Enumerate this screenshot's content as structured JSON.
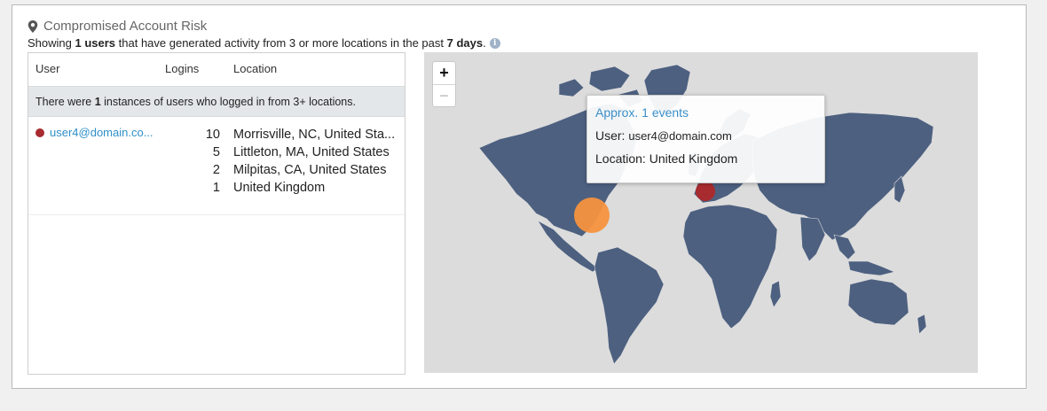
{
  "widget": {
    "title": "Compromised Account Risk",
    "subtitle": {
      "prefix": "Showing ",
      "user_count": "1 users",
      "middle": " that have generated activity from 3 or more locations in the past ",
      "period": "7 days",
      "suffix": "."
    }
  },
  "table": {
    "headers": {
      "user": "User",
      "logins": "Logins",
      "location": "Location"
    },
    "banner": {
      "prefix": "There were ",
      "count": "1",
      "suffix": " instances of users who logged in from 3+ locations."
    },
    "rows": [
      {
        "user": "user4@domain.co...",
        "status_color": "#a82b2f",
        "logins": [
          "10",
          "5",
          "2",
          "1"
        ],
        "locations": [
          "Morrisville, NC, United Sta...",
          "Littleton, MA, United States",
          "Milpitas, CA, United States",
          "United Kingdom"
        ]
      }
    ]
  },
  "map": {
    "zoom_in": "+",
    "zoom_out": "−",
    "markers": [
      {
        "name": "United States",
        "color": "#f5923e"
      },
      {
        "name": "United Kingdom",
        "color": "#a82b2f"
      }
    ],
    "tooltip": {
      "title": "Approx. 1 events",
      "user_label": "User: ",
      "user_value": "user4@domain.com",
      "location_label": "Location: ",
      "location_value": "United Kingdom"
    }
  },
  "colors": {
    "land": "#4d6080",
    "ocean": "#dcdcdc",
    "link": "#2f8fc8",
    "accent": "#3a8fc9"
  }
}
